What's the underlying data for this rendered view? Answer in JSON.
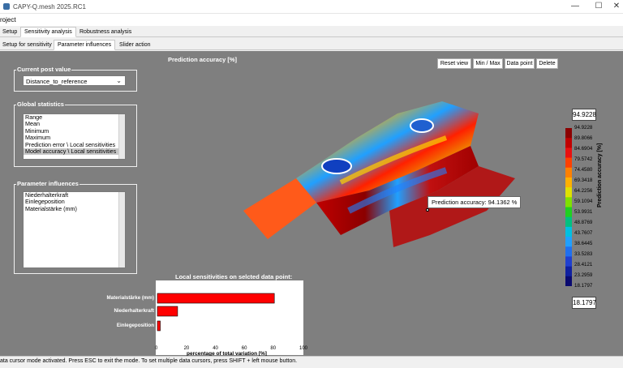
{
  "window": {
    "title": "CAPY-Q.mesh 2025.RC1",
    "minimize": "—",
    "maximize": "☐",
    "close": "✕"
  },
  "menu": {
    "project": "roject"
  },
  "tabs_main": [
    "Setup",
    "Sensitivity analysis",
    "Robustness analysis"
  ],
  "tabs_sub": [
    "Setup for sensitivity",
    "Parameter influences",
    "Slider action"
  ],
  "current_post": {
    "title": "Current post value",
    "value": "Distance_to_reference"
  },
  "global_stats": {
    "title": "Global statistics",
    "items": [
      "Range",
      "Mean",
      "Minimum",
      "Maximum",
      "Prediction error \\ Local sensitivities",
      "Model accuracy \\ Local sensitivities"
    ],
    "selected": 5
  },
  "param_influences": {
    "title": "Parameter influences",
    "items": [
      "Niederhalterkraft",
      "Einlegeposition",
      "Materialstärke (mm)"
    ]
  },
  "plot": {
    "title": "Prediction accuracy [%]",
    "tooltip": "Prediction accuracy: 94.1362 %"
  },
  "toolbar": {
    "reset": "Reset view",
    "minmax": "Min / Max",
    "datapoint": "Data point",
    "delete": "Delete"
  },
  "colorbar": {
    "max_box": "94.9228",
    "min_box": "18.1797",
    "title": "Prediction accuracy [%]",
    "ticks": [
      "94.9228",
      "89.8066",
      "84.6904",
      "79.5742",
      "74.4580",
      "69.3418",
      "64.2256",
      "59.1094",
      "53.9931",
      "48.8769",
      "43.7607",
      "38.6445",
      "33.5283",
      "28.4121",
      "23.2959",
      "18.1797"
    ],
    "colors": [
      "#8b0000",
      "#c00000",
      "#e81010",
      "#ff4000",
      "#ff8000",
      "#ffb000",
      "#e0e000",
      "#80e000",
      "#20d020",
      "#00c080",
      "#00c0e0",
      "#20a0ff",
      "#2070f0",
      "#2040d0",
      "#1020a0",
      "#0a0a70"
    ]
  },
  "chart_data": {
    "type": "bar",
    "title": "Local sensitivities on selcted data point:",
    "categories": [
      "Materialstärke (mm)",
      "Niederhalterkraft",
      "Einlegeposition"
    ],
    "values": [
      81,
      14,
      2
    ],
    "xlim": [
      0,
      100
    ],
    "xticks": [
      "0",
      "20",
      "40",
      "60",
      "80",
      "100"
    ],
    "xlabel": "percentage of total variation [%]",
    "color": "#ff0000"
  },
  "status": "ata cursor mode activated. Press ESC to exit the mode. To set multiple data cursors, press SHIFT + left mouse button."
}
